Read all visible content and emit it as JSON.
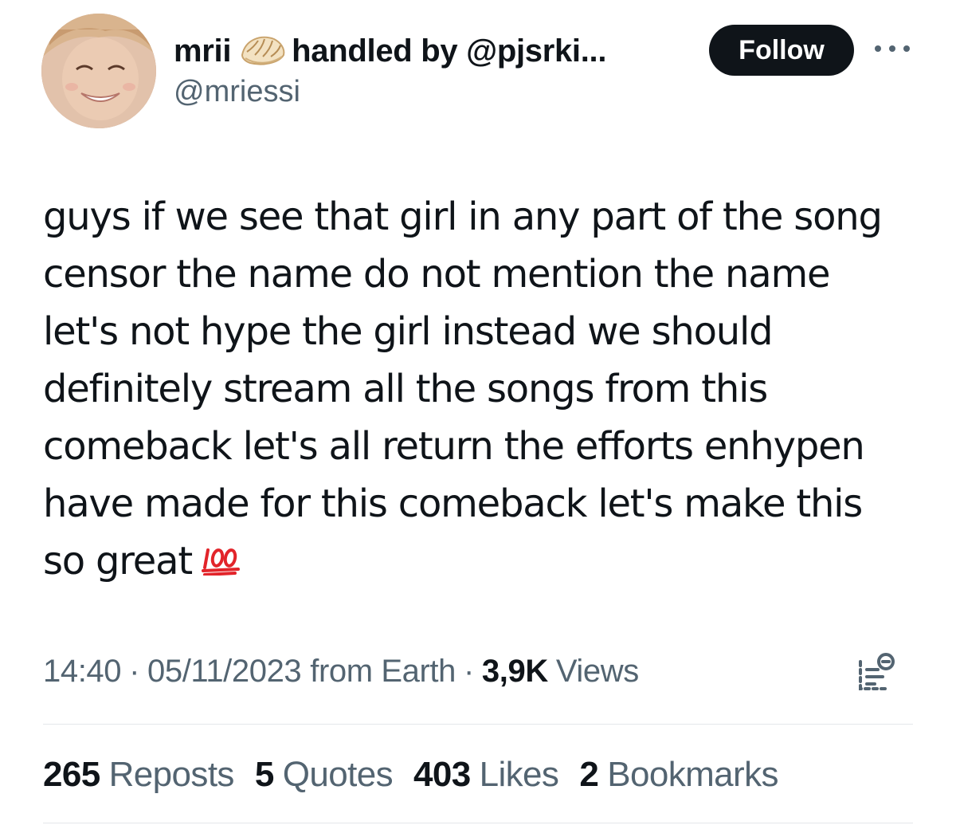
{
  "author": {
    "display_name": "mrii",
    "display_name_suffix": "handled by @pjsrki...",
    "handle": "@mriessi",
    "avatar_icon": "avatar-photo",
    "badge_icon": "dumpling-emoji"
  },
  "actions": {
    "follow_label": "Follow",
    "more_icon": "more-horizontal-icon"
  },
  "tweet": {
    "lines": [
      "guys if we see that girl in any part of the song",
      "censor the name do not mention the name",
      "let's not hype the girl instead we should",
      "definitely stream all the songs from this",
      "comeback let's all return the efforts enhypen",
      "have made for this comeback let's make this",
      "so great"
    ],
    "trailing_emoji": "hundred-points-emoji"
  },
  "meta": {
    "time": "14:40",
    "date": "05/11/2023",
    "source": "from Earth",
    "views_count": "3,9K",
    "views_label": "Views",
    "separator": "·"
  },
  "stats": [
    {
      "count": "265",
      "label": "Reposts"
    },
    {
      "count": "5",
      "label": "Quotes"
    },
    {
      "count": "403",
      "label": "Likes"
    },
    {
      "count": "2",
      "label": "Bookmarks"
    }
  ],
  "colors": {
    "text_primary": "#0f1419",
    "text_secondary": "#536471",
    "follow_bg": "#0f1419",
    "divider": "#e4e7ea",
    "hundred_red": "#e2242a"
  }
}
